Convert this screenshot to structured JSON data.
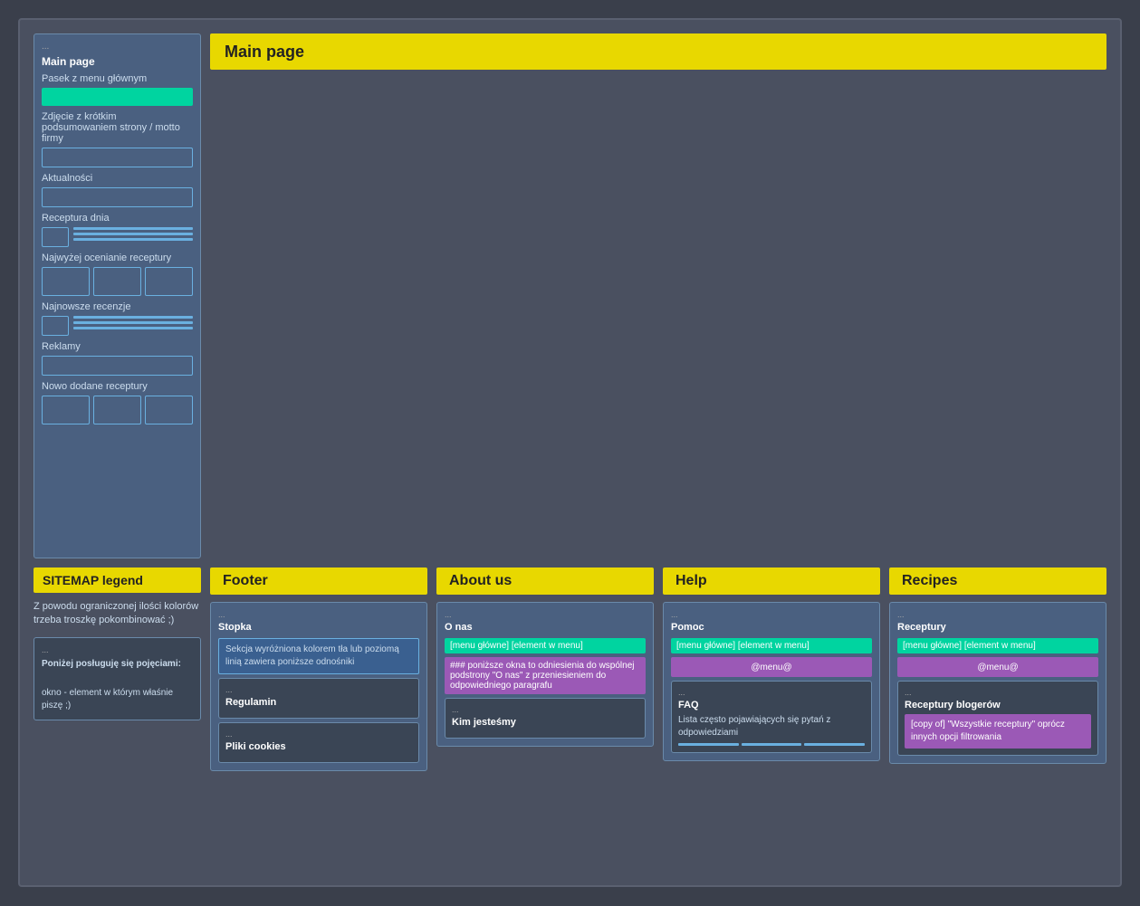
{
  "outer": {
    "topLeft": {
      "dots": "...",
      "title": "Main page",
      "sections": [
        {
          "label": "Pasek z menu głównym",
          "type": "green-bar"
        },
        {
          "label": "Zdjęcie z krótkim podsumowaniem strony / motto firmy",
          "type": "blue-rect"
        },
        {
          "label": "Aktualności",
          "type": "blue-rect"
        },
        {
          "label": "Receptura dnia",
          "type": "inline-tiny-lines"
        },
        {
          "label": "Najwyżej ocenianie receptury",
          "type": "triple-small"
        },
        {
          "label": "Najnowsze recenzje",
          "type": "inline-tiny-lines"
        },
        {
          "label": "Reklamy",
          "type": "blue-rect"
        },
        {
          "label": "Nowo dodane receptury",
          "type": "triple-small"
        }
      ]
    },
    "mainPageHeader": "Main page",
    "bottomColumns": [
      {
        "header": "Footer",
        "card": {
          "dots": "...",
          "title": "Stopka",
          "description": "Sekcja wyróżniona kolorem tła lub poziomą linią\nzawiera poniższe odnośniki",
          "subCards": [
            {
              "dots": "...",
              "title": "Regulamin"
            },
            {
              "dots": "...",
              "title": "Pliki cookies"
            }
          ]
        }
      },
      {
        "header": "About us",
        "card": {
          "dots": "...",
          "title": "O nas",
          "menuTag": "[menu główne]\n[element w menu]",
          "purpleText": "### poniższe okna to odniesienia do wspólnej podstrony \"O nas\" z przeniesieniem do odpowiedniego paragrafu",
          "subCards": [
            {
              "dots": "...",
              "title": "Kim jesteśmy"
            }
          ]
        }
      },
      {
        "header": "Help",
        "card": {
          "dots": "...",
          "title": "Pomoc",
          "menuTag": "[menu główne]\n[element w menu]",
          "purpleBar": "@menu@",
          "subCards": [
            {
              "dots": "...",
              "title": "FAQ",
              "description": "Lista często pojawiających się pytań z odpowiedziami",
              "hasLines": true
            }
          ]
        }
      },
      {
        "header": "Recipes",
        "card": {
          "dots": "...",
          "title": "Receptury",
          "menuTag": "[menu główne]\n[element w menu]",
          "purpleBar": "@menu@",
          "subCards": [
            {
              "dots": "...",
              "title": "Receptury blogerów",
              "copyText": "[copy of] \"Wszystkie receptury\" oprócz innych opcji filtrowania"
            }
          ]
        }
      }
    ],
    "legend": {
      "header": "SITEMAP legend",
      "text": "Z powodu ograniczonej ilości kolorów trzeba troszkę pokombinować ;)",
      "box1": {
        "dots": "...",
        "title": "Poniżej posługuję się pojęciami:",
        "text": "okno - element w którym właśnie piszę ;)"
      }
    }
  }
}
